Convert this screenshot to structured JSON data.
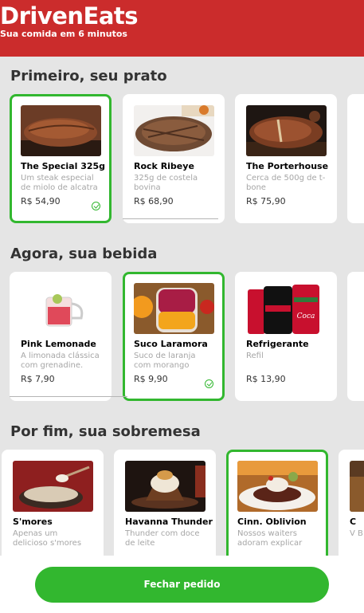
{
  "header": {
    "brand": "DrivenEats",
    "tagline": "Sua comida em 6 minutos"
  },
  "sections": [
    {
      "title": "Primeiro, seu prato",
      "items": [
        {
          "name": "The Special 325g",
          "desc": "Um steak especial de miolo de alcatra",
          "price": "R$ 54,90",
          "selected": true,
          "image": "steak-special-photo"
        },
        {
          "name": "Rock Ribeye",
          "desc": "325g de costela bovina",
          "price": "R$ 68,90",
          "selected": false,
          "image": "ribeye-photo"
        },
        {
          "name": "The Porterhouse",
          "desc": "Cerca de 500g de t-bone",
          "price": "R$ 75,90",
          "selected": false,
          "image": "porterhouse-photo"
        }
      ]
    },
    {
      "title": "Agora, sua bebida",
      "items": [
        {
          "name": "Pink Lemonade",
          "desc": "A limonada clássica com grenadine.",
          "price": "R$ 7,90",
          "selected": false,
          "image": "pink-lemonade-photo"
        },
        {
          "name": "Suco Laramora",
          "desc": "Suco de laranja com morango",
          "price": "R$ 9,90",
          "selected": true,
          "image": "laramora-juice-photo"
        },
        {
          "name": "Refrigerante",
          "desc": "Refil",
          "price": "R$ 13,90",
          "selected": false,
          "image": "soda-cans-photo"
        }
      ]
    },
    {
      "title": "Por fim, sua sobremesa",
      "items": [
        {
          "name": "S'mores",
          "desc": "Apenas um delicioso s'mores",
          "price": "",
          "selected": false,
          "image": "smores-photo"
        },
        {
          "name": "Havanna Thunder",
          "desc": "Thunder com doce de leite",
          "price": "",
          "selected": false,
          "image": "havanna-thunder-photo"
        },
        {
          "name": "Cinn. Oblivion",
          "desc": "Nossos waiters adoram explicar",
          "price": "",
          "selected": true,
          "image": "cinn-oblivion-photo"
        },
        {
          "name": "C",
          "desc": "V B",
          "price": "",
          "selected": false,
          "image": "partial-dessert-photo"
        }
      ]
    }
  ],
  "footer": {
    "button_label": "Fechar pedido"
  },
  "colors": {
    "header_red": "#cb2c2c",
    "accent_green": "#32b72f",
    "background": "#e5e5e5"
  }
}
